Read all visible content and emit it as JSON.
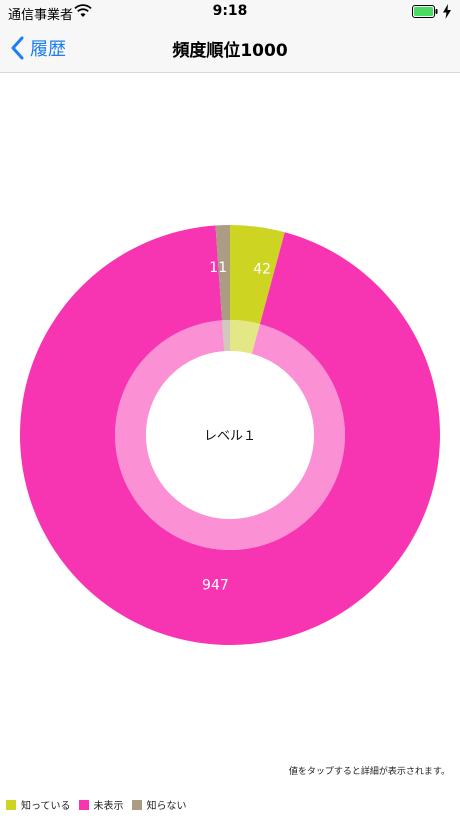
{
  "status": {
    "carrier": "通信事業者",
    "time": "9:18"
  },
  "nav": {
    "back_label": "履歴",
    "title": "頻度順位1000"
  },
  "chart_data": {
    "type": "pie",
    "center_label": "レベル１",
    "categories": [
      "知っている",
      "未表示",
      "知らない"
    ],
    "values": [
      42,
      947,
      11
    ],
    "colors": [
      "#cdd421",
      "#f734b1",
      "#ab9c83"
    ],
    "legend_position": "bottom-left"
  },
  "hint": "値をタップすると詳細が表示されます。"
}
